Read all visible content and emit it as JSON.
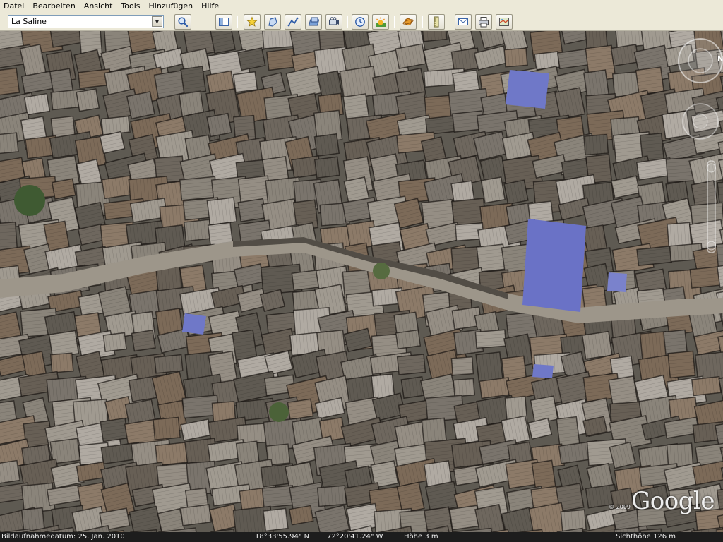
{
  "menu": [
    "Datei",
    "Bearbeiten",
    "Ansicht",
    "Tools",
    "Hinzufügen",
    "Hilfe"
  ],
  "toolbar": {
    "location_value": "La Saline",
    "buttons": [
      {
        "name": "search-icon",
        "icon": "magnifier"
      },
      {
        "name": "sidebar-toggle-icon",
        "icon": "sidebar"
      },
      {
        "name": "add-placemark-icon",
        "icon": "pin-star"
      },
      {
        "name": "add-polygon-icon",
        "icon": "polygon"
      },
      {
        "name": "add-path-icon",
        "icon": "path"
      },
      {
        "name": "add-image-overlay-icon",
        "icon": "overlay"
      },
      {
        "name": "record-tour-icon",
        "icon": "camera"
      },
      {
        "name": "historical-imagery-icon",
        "icon": "clock"
      },
      {
        "name": "sunlight-icon",
        "icon": "sun"
      },
      {
        "name": "switch-planet-icon",
        "icon": "planet"
      },
      {
        "name": "ruler-icon",
        "icon": "ruler"
      },
      {
        "name": "email-icon",
        "icon": "envelope"
      },
      {
        "name": "print-icon",
        "icon": "printer"
      },
      {
        "name": "view-in-maps-icon",
        "icon": "map"
      }
    ]
  },
  "map": {
    "copyright": "© 2009",
    "logo": "Google"
  },
  "statusbar": {
    "imagery_date": "Bildaufnahmedatum: 25. Jan. 2010",
    "latitude": "18°33'55.94\" N",
    "longitude": "72°20'41.24\" W",
    "elevation": "Höhe  3 m",
    "eye_altitude": "Sichthöhe   126 m"
  },
  "colors": {
    "toolbar_bg": "#ece9d8",
    "tarp_blue": "#6f78c8",
    "statusbar_bg": "#1d1d1d"
  }
}
